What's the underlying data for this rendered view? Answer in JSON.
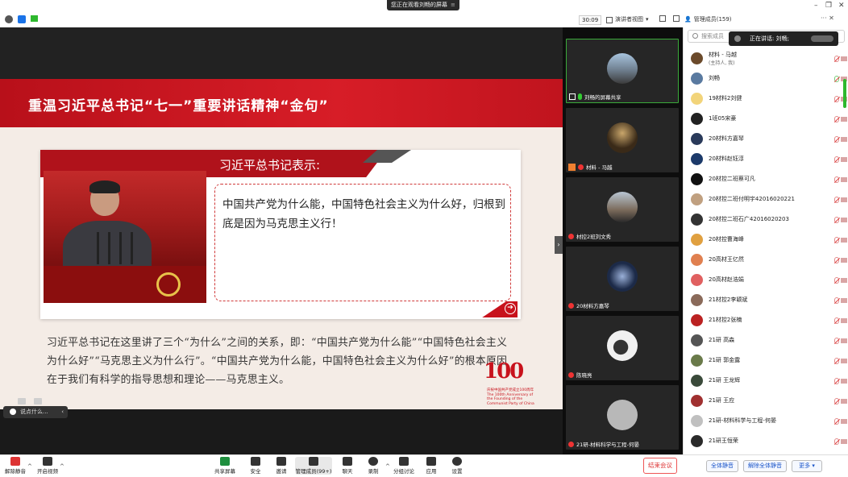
{
  "topbar": {
    "share_tip": "您正在观看刘畅的屏幕",
    "share_tip_menu": "≡",
    "timer": "30:09",
    "view_mode": "演讲者视图",
    "panel_title": "管理成员(159)",
    "more": "···"
  },
  "slide": {
    "banner_title": "重温习近平总书记“七一”重要讲话精神“金句”",
    "card_heading": "习近平总书记表示:",
    "quote": "中国共产党为什么能，中国特色社会主义为什么好，归根到底是因为马克思主义行！",
    "paragraph": "习近平总书记在这里讲了三个“为什么”之间的关系，即：“中国共产党为什么能”“中国特色社会主义为什么好”“马克思主义为什么行”。“中国共产党为什么能，中国特色社会主义为什么好”的根本原因在于我们有科学的指导思想和理论——马克思主义。",
    "logo_number": "100",
    "logo_caption_cn": "庆祝中国共产党成立100周年",
    "logo_caption_en": "The 100th Anniversary of the Founding of the Communist Party of China",
    "chat_placeholder": "说点什么...",
    "chat_arrow": "‹"
  },
  "videos": [
    {
      "name": "刘畅的屏幕共享",
      "color": "#6f7f8f",
      "mic": "on",
      "active": true
    },
    {
      "name": "材料 - 马越",
      "color": "#3a2a18",
      "mic": "off",
      "active": false
    },
    {
      "name": "材控2班刘文秀",
      "color": "#7a6a5a",
      "mic": "off",
      "active": false
    },
    {
      "name": "20材料方嘉琴",
      "color": "#1c2a48",
      "mic": "off",
      "active": false
    },
    {
      "name": "陈晓亮",
      "color": "#f0f0f0",
      "mic": "off",
      "active": false
    },
    {
      "name": "21研-材料科学与工程-何晏",
      "color": "#b8b8b8",
      "mic": "off",
      "active": false
    }
  ],
  "participants": {
    "search_placeholder": "搜索成员",
    "speaking_label": "正在讲话: 刘畅;",
    "list": [
      {
        "name": "材料 - 马越",
        "sub": "(主持人, 我)",
        "color": "#6b4a2b"
      },
      {
        "name": "刘畅",
        "sub": "",
        "color": "#5a7aa0"
      },
      {
        "name": "19材料2刘健",
        "sub": "",
        "color": "#f2d47a"
      },
      {
        "name": "1班05宋豪",
        "sub": "",
        "color": "#222222"
      },
      {
        "name": "20材料方嘉琴",
        "sub": "",
        "color": "#2a3a5a"
      },
      {
        "name": "20材料赵钰淳",
        "sub": "",
        "color": "#1c3a6a"
      },
      {
        "name": "20材控二班蔡可凡",
        "sub": "",
        "color": "#111111"
      },
      {
        "name": "20材控二班付明宇42016020221",
        "sub": "",
        "color": "#c0a080"
      },
      {
        "name": "20材控二班石广42016020203",
        "sub": "",
        "color": "#333333"
      },
      {
        "name": "20材控曹海峰",
        "sub": "",
        "color": "#e0a040"
      },
      {
        "name": "20高材王亿然",
        "sub": "",
        "color": "#e08050"
      },
      {
        "name": "20高材赵浩娟",
        "sub": "",
        "color": "#e06060"
      },
      {
        "name": "21材控2李颖斌",
        "sub": "",
        "color": "#8a6a5a"
      },
      {
        "name": "21材控2张楠",
        "sub": "",
        "color": "#bb2222"
      },
      {
        "name": "21研 高森",
        "sub": "",
        "color": "#555555"
      },
      {
        "name": "21研 郭金露",
        "sub": "",
        "color": "#6a7a4a"
      },
      {
        "name": "21研 王龙辉",
        "sub": "",
        "color": "#3a4a3a"
      },
      {
        "name": "21研 王应",
        "sub": "",
        "color": "#a03030"
      },
      {
        "name": "21研-材料科学与工程-何晏",
        "sub": "",
        "color": "#c0c0c0"
      },
      {
        "name": "21研王恒荣",
        "sub": "",
        "color": "#2a2a2a"
      }
    ]
  },
  "toolbar": {
    "mute": "解除静音",
    "video": "开启视频",
    "share": "共享屏幕",
    "security": "安全",
    "invite": "邀请",
    "members": "管理成员(99+)",
    "chat": "聊天",
    "record": "录制",
    "breakout": "分组讨论",
    "apps": "应用",
    "settings": "设置",
    "end": "结束会议",
    "mute_all": "全体静音",
    "unmute_all": "解除全体静音",
    "more": "更多 ▾"
  }
}
